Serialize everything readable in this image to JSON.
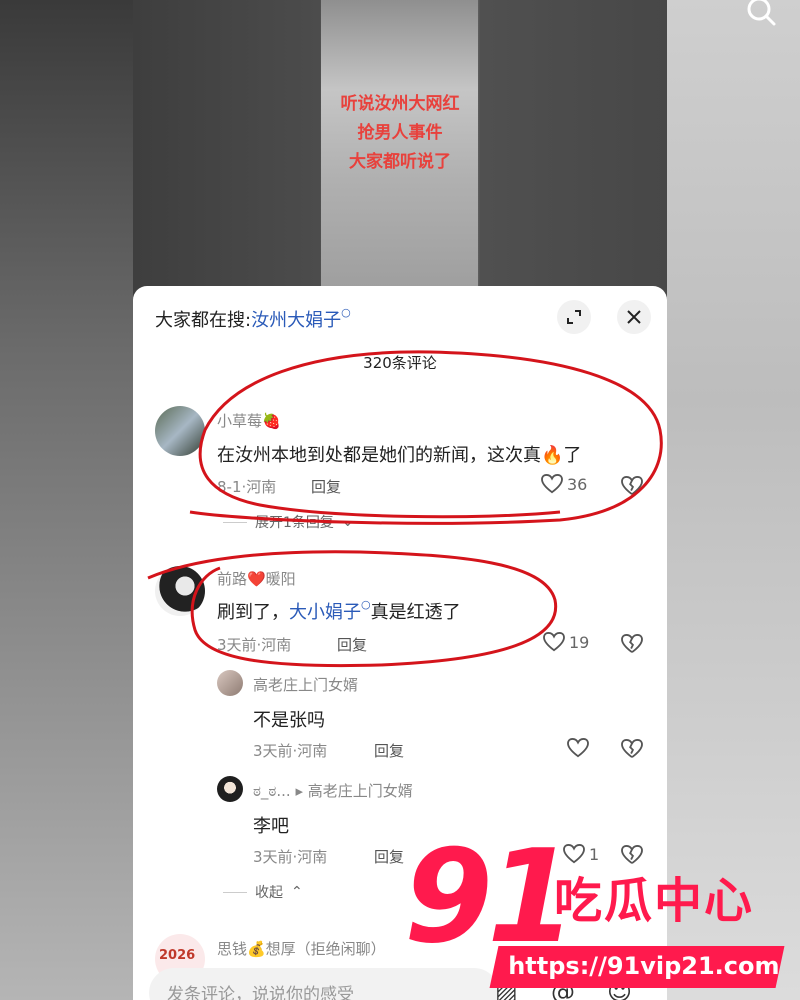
{
  "video": {
    "overlay_lines": [
      "听说汝州大网红",
      "抢男人事件",
      "大家都听说了"
    ]
  },
  "sheet": {
    "hot_search_label": "大家都在搜:",
    "hot_search_keyword": "汝州大娟子",
    "comment_count": "320条评论",
    "comments": [
      {
        "user": "小草莓🍓",
        "text": "在汝州本地到处都是她们的新闻，这次真🔥了",
        "meta": "8-1·河南",
        "reply_label": "回复",
        "likes": "36",
        "expand_label": "展开1条回复"
      },
      {
        "user": "前路❤️暖阳",
        "text_before": "刷到了，",
        "text_keyword": "大小娟子",
        "text_after": "真是红透了",
        "meta": "3天前·河南",
        "reply_label": "回复",
        "likes": "19"
      },
      {
        "user": "高老庄上门女婿",
        "text": "不是张吗",
        "meta": "3天前·河南",
        "reply_label": "回复",
        "likes": ""
      },
      {
        "user": "ಠ_ಠ...",
        "reply_to": "高老庄上门女婿",
        "text": "李吧",
        "meta": "3天前·河南",
        "reply_label": "回复",
        "likes": "1",
        "collapse_label": "收起"
      },
      {
        "user": "思钱💰想厚（拒绝闲聊）",
        "avatar_text": "2026"
      }
    ],
    "input_placeholder": "发条评论，说说你的感受"
  },
  "watermark": {
    "number": "91",
    "name": "吃瓜中心",
    "url": "https://91vip21.com"
  },
  "colors": {
    "keyword": "#2a5ab8",
    "annotation": "#d4141b",
    "watermark": "#ff1a4d",
    "overlay_text": "#e8413c"
  }
}
